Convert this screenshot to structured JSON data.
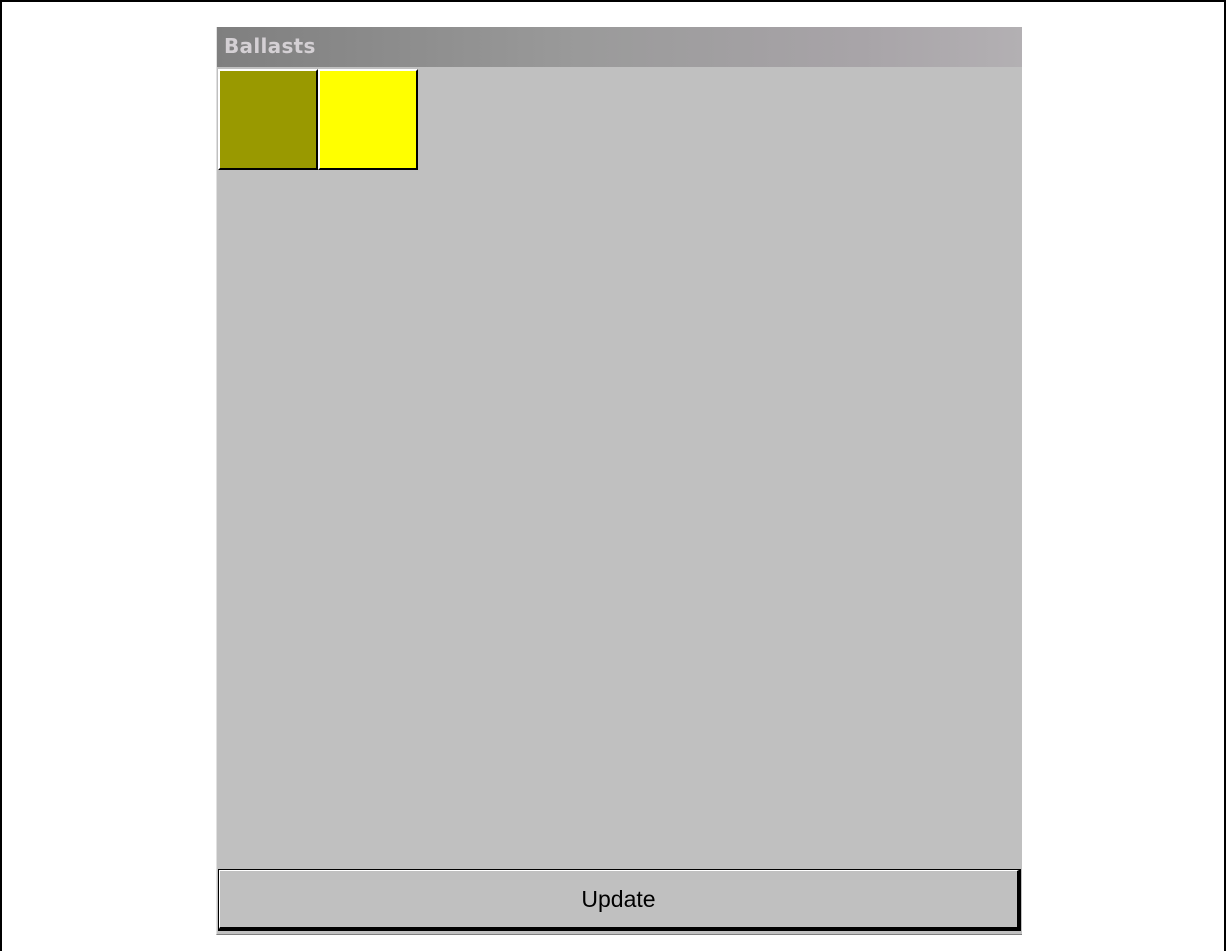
{
  "window": {
    "title": "Ballasts"
  },
  "swatches": [
    {
      "name": "ballast-swatch-olive",
      "color": "#999900"
    },
    {
      "name": "ballast-swatch-yellow",
      "color": "#ffff00"
    }
  ],
  "footer": {
    "update_label": "Update"
  }
}
